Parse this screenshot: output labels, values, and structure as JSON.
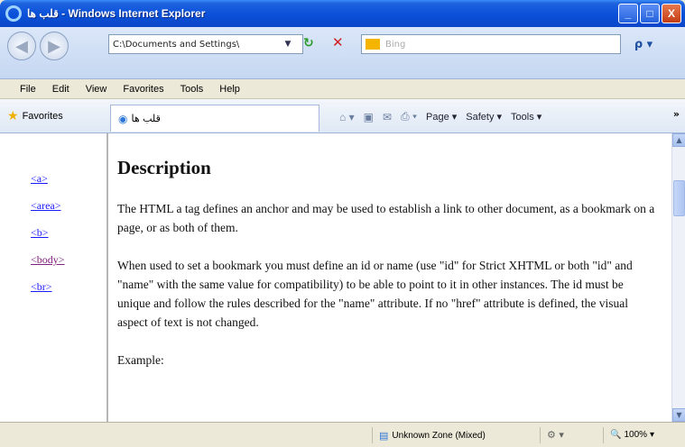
{
  "window": {
    "title": "قلب ها - Windows Internet Explorer",
    "buttons": {
      "minimize": "_",
      "maximize": "□",
      "close": "X"
    }
  },
  "address_bar": {
    "back": "◀",
    "forward": "▶",
    "url": "C:\\Documents and Settings\\",
    "dropdown": "▼",
    "refresh": "↻",
    "stop": "✕",
    "search_placeholder": "Bing",
    "search_go": "ρ ▾"
  },
  "menu": [
    "File",
    "Edit",
    "View",
    "Favorites",
    "Tools",
    "Help"
  ],
  "favorites_bar": {
    "favorites_label": "Favorites",
    "tab_title": "قلب ها",
    "commands": [
      "Page ▾",
      "Safety ▾",
      "Tools ▾"
    ],
    "more": "»"
  },
  "left_nav": {
    "links": [
      "<a>",
      "<area>",
      "<b>",
      "<body>",
      "<br>"
    ]
  },
  "main": {
    "heading": "Description",
    "paragraphs": [
      "The HTML a tag defines an anchor and may be used to establish a link to other document, as a bookmark on a page, or as both of them.",
      "When used to set a bookmark you must define an id or name (use \"id\" for Strict XHTML or both \"id\" and \"name\" with the same value for compatibility) to be able to point to it in other instances. The id must be unique and follow the rules described for the \"name\" attribute. If no \"href\" attribute is defined, the visual aspect of text is not changed.",
      "Example:"
    ]
  },
  "status_bar": {
    "zone": "Unknown Zone (Mixed)",
    "zoom": "100%"
  },
  "colors": {
    "titlebar": "#0a50d8",
    "link": "#1a1aff",
    "visited_link": "#80207f"
  },
  "icons": [
    "ie-icon",
    "back-icon",
    "forward-icon",
    "refresh-icon",
    "stop-icon",
    "star-icon",
    "home-icon",
    "print-icon",
    "zone-icon",
    "zoom-icon"
  ]
}
